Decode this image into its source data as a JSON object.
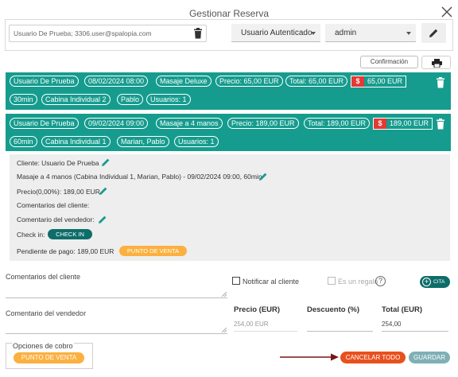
{
  "dialog": {
    "title": "Gestionar Reserva"
  },
  "top": {
    "client_value": "Usuario De Prueba; 3306.user@spalopia.com",
    "user_type": "Usuario Autenticado",
    "operator": "admin",
    "confirm_label": "Confirmación"
  },
  "bookings": [
    {
      "line1": [
        "Usuario De Prueba",
        "08/02/2024 08:00",
        "Masaje Deluxe",
        "Precio: 65,00 EUR",
        "Total: 65,00 EUR"
      ],
      "paid_amount": "65,00 EUR",
      "line2": [
        "30min",
        "Cabina Individual 2",
        "Pablo",
        "Usuarios: 1"
      ]
    },
    {
      "line1": [
        "Usuario De Prueba",
        "09/02/2024 09:00",
        "Masaje a 4 manos",
        "Precio: 189,00 EUR",
        "Total: 189,00 EUR"
      ],
      "paid_amount": "189,00 EUR",
      "line2": [
        "60min",
        "Cabina Individual 1",
        "Marian, Pablo",
        "Usuarios: 1"
      ]
    }
  ],
  "detail": {
    "client": "Cliente: Usuario De Prueba",
    "service": "Masaje a 4 manos (Cabina Individual 1, Marian, Pablo) - 09/02/2024 09:00, 60min",
    "price": "Precio(0,00%): 189,00 EUR",
    "client_comments": "Comentarios del cliente:",
    "seller_comment": "Comentario del vendedor:",
    "checkin_label": "Check in:",
    "checkin_button": "CHECK IN",
    "pending": "Pendiente de pago:  189,00 EUR",
    "pdv_button": "PUNTO DE VENTA"
  },
  "form": {
    "client_comments_label": "Comentarios del cliente",
    "notify_label": "Notificar al cliente",
    "gift_label": "Es un regalo",
    "cita_label": "CITA",
    "seller_comment_label": "Comentario del vendedor",
    "price_header": "Precio (EUR)",
    "discount_header": "Descuento (%)",
    "total_header": "Total (EUR)",
    "price_value": "254,00 EUR",
    "total_value": "254,00",
    "payment_options_label": "Opciones de cobro",
    "pdv_button": "PUNTO DE VENTA",
    "cancel_all": "CANCELAR TODO",
    "save": "GUARDAR"
  },
  "colors": {
    "teal": "#169c8e",
    "dark_teal": "#0e6d6a",
    "orange": "#fbb040",
    "cancel": "#e8501e",
    "save": "#7fb0b4",
    "paid_red": "#e53935"
  }
}
